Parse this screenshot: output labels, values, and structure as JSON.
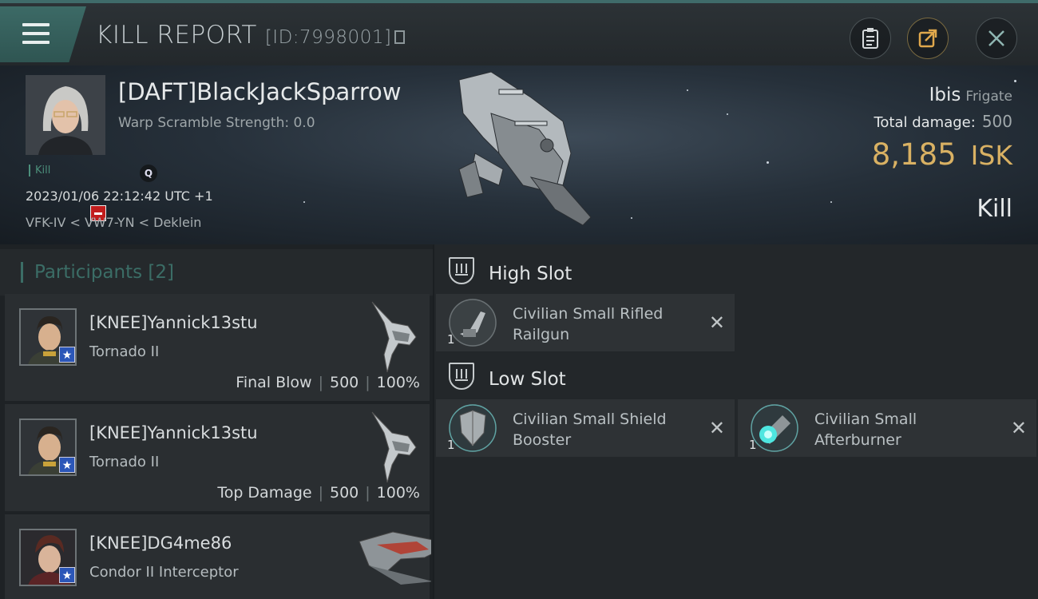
{
  "header": {
    "title": "KILL REPORT",
    "report_id": "[ID:7998001]"
  },
  "victim": {
    "pilot_name": "[DAFT]BlackJackSparrow",
    "warp_scramble": "Warp Scramble Strength: 0.0",
    "kill_tag": "Kill",
    "q_label": "Q",
    "datetime": "2023/01/06 22:12:42 UTC +1",
    "location": "VFK-IV < VW7-YN < Deklein",
    "ship_name": "Ibis",
    "ship_class": "Frigate",
    "total_damage_label": "Total damage:",
    "total_damage_value": "500",
    "isk_value": "8,185",
    "isk_unit": "ISK",
    "report_kind": "Kill"
  },
  "participants": {
    "label": "Participants [2]",
    "rows": [
      {
        "name": "[KNEE]Yannick13stu",
        "ship": "Tornado II",
        "role": "Final Blow",
        "damage": "500",
        "percent": "100%"
      },
      {
        "name": "[KNEE]Yannick13stu",
        "ship": "Tornado II",
        "role": "Top Damage",
        "damage": "500",
        "percent": "100%"
      },
      {
        "name": "[KNEE]DG4me86",
        "ship": "Condor II Interceptor",
        "role": "",
        "damage": "",
        "percent": ""
      }
    ]
  },
  "fitting": {
    "high_slot_label": "High Slot",
    "low_slot_label": "Low Slot",
    "high_items": [
      {
        "name": "Civilian Small Rifled Railgun",
        "qty": "1",
        "icon": "railgun-icon"
      }
    ],
    "low_items": [
      {
        "name": "Civilian Small Shield Booster",
        "qty": "1",
        "icon": "shield-booster-icon"
      },
      {
        "name": "Civilian Small Afterburner",
        "qty": "1",
        "icon": "afterburner-icon"
      }
    ]
  },
  "colors": {
    "accent_teal": "#3b6d66",
    "isk_gold": "#d9b163",
    "corp_badge_red": "#c21d1d",
    "alliance_badge_blue": "#2b56b8"
  }
}
